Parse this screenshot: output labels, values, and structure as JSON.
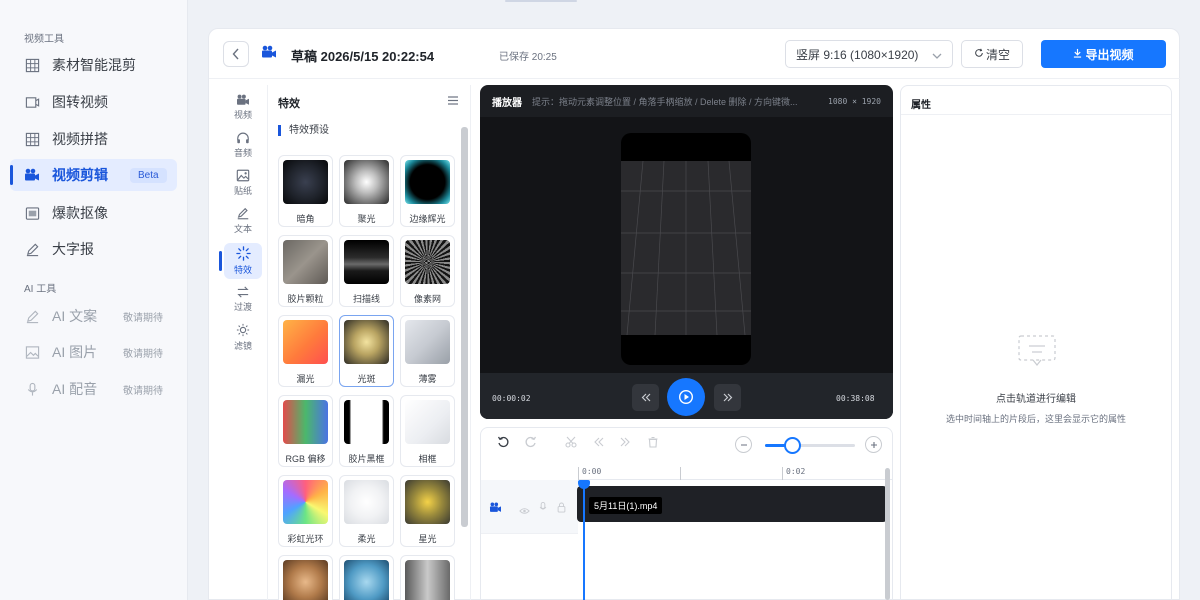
{
  "sidebar": {
    "section_video": "视频工具",
    "section_ai": "AI 工具",
    "items": [
      {
        "label": "素材智能混剪",
        "icon": "grid-icon"
      },
      {
        "label": "图转视频",
        "icon": "image-video-icon"
      },
      {
        "label": "视频拼搭",
        "icon": "grid-icon"
      },
      {
        "label": "视频剪辑",
        "icon": "camera-icon",
        "badge": "Beta",
        "active": true
      },
      {
        "label": "爆款抠像",
        "icon": "cutout-icon"
      },
      {
        "label": "大字报",
        "icon": "pen-icon"
      }
    ],
    "ai_items": [
      {
        "label": "AI 文案",
        "soon": "敬请期待",
        "icon": "pen-icon"
      },
      {
        "label": "AI 图片",
        "soon": "敬请期待",
        "icon": "picture-icon"
      },
      {
        "label": "AI 配音",
        "soon": "敬请期待",
        "icon": "microphone-icon"
      }
    ]
  },
  "topbar": {
    "draft_title": "草稿 2026/5/15 20:22:54",
    "saved": "已保存 20:25",
    "ratio": "竖屏 9:16 (1080×1920)",
    "clear": "清空",
    "export": "导出视频"
  },
  "tools": [
    {
      "label": "视频",
      "icon": "video-icon"
    },
    {
      "label": "音频",
      "icon": "headphones-icon"
    },
    {
      "label": "贴纸",
      "icon": "sticker-icon"
    },
    {
      "label": "文本",
      "icon": "text-pen-icon"
    },
    {
      "label": "特效",
      "icon": "sparkle-icon",
      "active": true
    },
    {
      "label": "过渡",
      "icon": "transition-icon"
    },
    {
      "label": "滤镜",
      "icon": "sun-icon"
    }
  ],
  "effects": {
    "title": "特效",
    "subtitle": "特效预设",
    "items": [
      {
        "label": "暗角"
      },
      {
        "label": "聚光"
      },
      {
        "label": "边缘辉光"
      },
      {
        "label": "胶片颗粒"
      },
      {
        "label": "扫描线"
      },
      {
        "label": "像素网"
      },
      {
        "label": "漏光"
      },
      {
        "label": "光斑",
        "selected": true
      },
      {
        "label": "薄雾"
      },
      {
        "label": "RGB 偏移"
      },
      {
        "label": "胶片黑框"
      },
      {
        "label": "相框"
      },
      {
        "label": "彩虹光环"
      },
      {
        "label": "柔光"
      },
      {
        "label": "星光"
      },
      {
        "label": ""
      },
      {
        "label": ""
      },
      {
        "label": ""
      }
    ]
  },
  "player": {
    "title": "播放器",
    "hint": "提示：拖动元素调整位置 / 角落手柄缩放 / Delete 删除 / 方向键微...",
    "resolution": "1080 × 1920",
    "current_time": "00:00:02",
    "total_time": "00:38:08"
  },
  "timeline": {
    "ticks": [
      "0:00",
      "",
      "0:02"
    ],
    "clip_name": "5月11日(1).mp4",
    "zoom_level": 0.3
  },
  "properties": {
    "title": "属性",
    "empty_title": "点击轨道进行编辑",
    "empty_desc": "选中时间轴上的片段后，这里会显示它的属性"
  }
}
